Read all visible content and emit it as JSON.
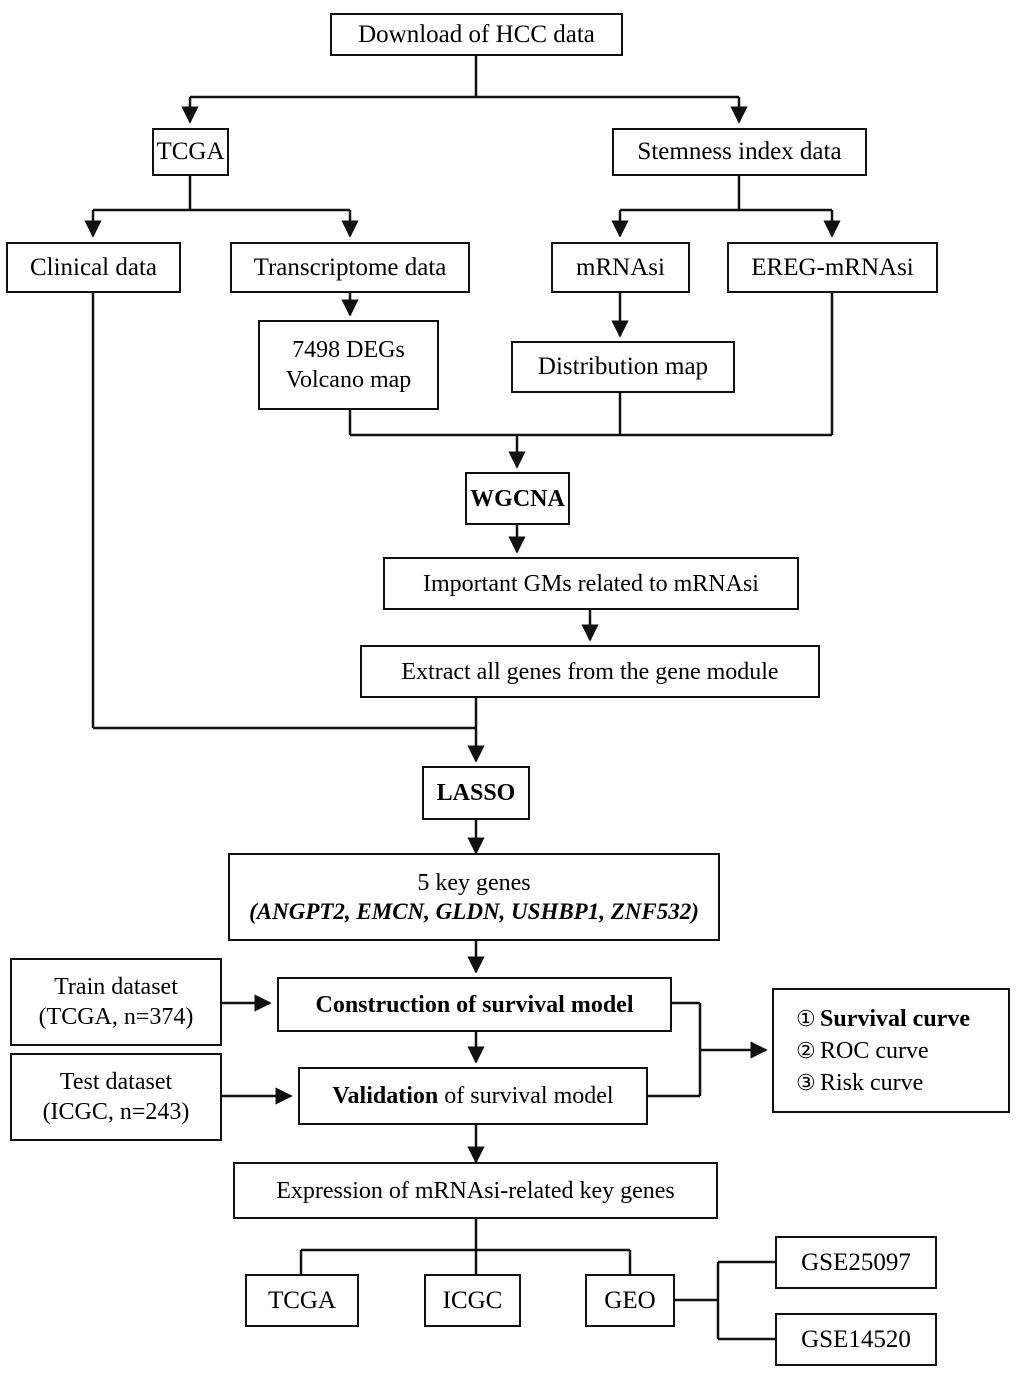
{
  "figure": {
    "type": "flowchart",
    "title": "HCC data analysis workflow"
  },
  "nodes": {
    "download": "Download of HCC data",
    "tcga_top": "TCGA",
    "stemness": "Stemness index data",
    "clinical": "Clinical data",
    "transcriptome": "Transcriptome data",
    "mrnasi": "mRNAsi",
    "ereg_mrnasi": "EREG-mRNAsi",
    "degs_line1": "7498 DEGs",
    "degs_line2": "Volcano map",
    "distribution": "Distribution map",
    "wgcna": "WGCNA",
    "important_gms": "Important GMs related to mRNAsi",
    "extract_genes": "Extract all genes from the gene module",
    "lasso": "LASSO",
    "keygenes_line1": "5 key genes",
    "keygenes_line2": "(ANGPT2, EMCN, GLDN, USHBP1, ZNF532)",
    "train_line1": "Train dataset",
    "train_line2": "(TCGA, n=374)",
    "test_line1": "Test dataset",
    "test_line2": "(ICGC, n=243)",
    "construction": "Construction of survival model",
    "validation_bold": "Validation",
    "validation_rest": " of survival model",
    "expression": "Expression of mRNAsi-related key genes",
    "tcga_bottom": "TCGA",
    "icgc_bottom": "ICGC",
    "geo_bottom": "GEO",
    "gse25097": "GSE25097",
    "gse14520": "GSE14520"
  },
  "outputs_panel": {
    "items": [
      {
        "marker": "①",
        "label": "Survival curve",
        "bold": true
      },
      {
        "marker": "②",
        "label": "ROC curve",
        "bold": false
      },
      {
        "marker": "③",
        "label": "Risk curve",
        "bold": false
      }
    ]
  },
  "key_genes": [
    "ANGPT2",
    "EMCN",
    "GLDN",
    "USHBP1",
    "ZNF532"
  ],
  "colors": {
    "stroke": "#111111",
    "background": "#ffffff",
    "text": "#000000"
  }
}
